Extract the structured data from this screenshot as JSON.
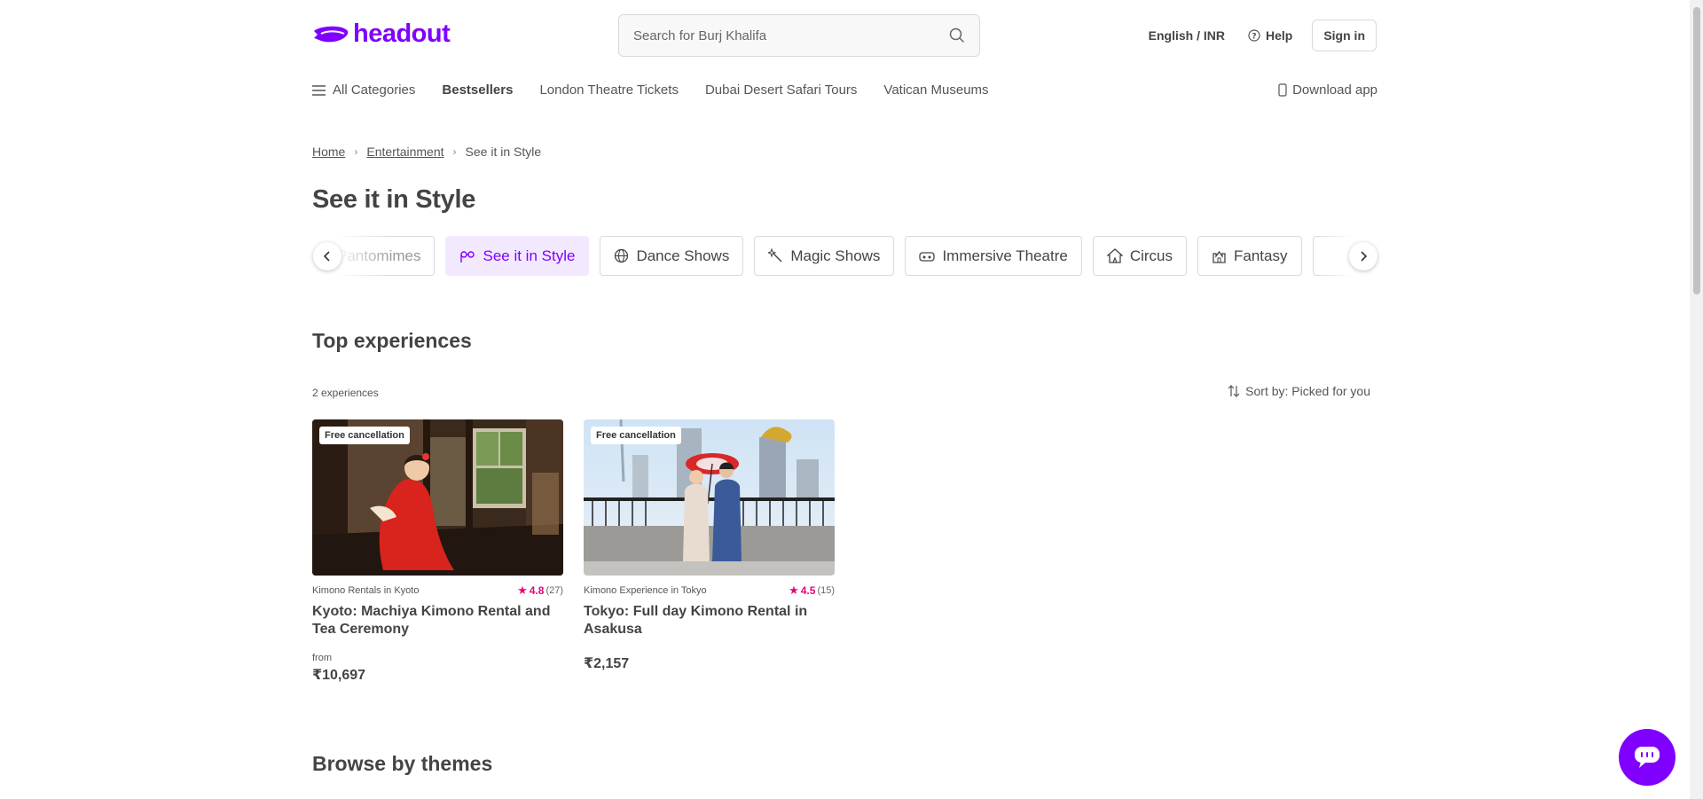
{
  "header": {
    "logo_text": "headout",
    "brand_color": "#8000ff",
    "search_placeholder": "Search for Burj Khalifa",
    "language_currency": "English / INR",
    "help": "Help",
    "sign_in": "Sign in"
  },
  "nav": {
    "items": [
      "All Categories",
      "Bestsellers",
      "London Theatre Tickets",
      "Dubai Desert Safari Tours",
      "Vatican Museums"
    ],
    "download_app": "Download app"
  },
  "breadcrumb": {
    "items": [
      "Home",
      "Entertainment",
      "See it in Style"
    ]
  },
  "page_title": "See it in Style",
  "categories": {
    "chips": [
      {
        "label": "Pantomimes",
        "icon": "mask-icon"
      },
      {
        "label": "See it in Style",
        "icon": "glasses-icon"
      },
      {
        "label": "Dance Shows",
        "icon": "globe-icon"
      },
      {
        "label": "Magic Shows",
        "icon": "magic-wand-icon"
      },
      {
        "label": "Immersive Theatre",
        "icon": "vr-headset-icon"
      },
      {
        "label": "Circus",
        "icon": "circus-tent-icon"
      },
      {
        "label": "Fantasy",
        "icon": "castle-icon"
      }
    ],
    "active": "See it in Style"
  },
  "top_experiences": {
    "title": "Top experiences",
    "count": "2 experiences",
    "sort_label": "Sort by: Picked for you",
    "cards": [
      {
        "badge": "Free cancellation",
        "category": "Kimono Rentals in Kyoto",
        "rating": "4.8",
        "reviews": "(27)",
        "title": "Kyoto: Machiya Kimono Rental and Tea Ceremony",
        "price_prefix": "from",
        "price": "₹10,697"
      },
      {
        "badge": "Free cancellation",
        "category": "Kimono Experience in Tokyo",
        "rating": "4.5",
        "reviews": "(15)",
        "title": "Tokyo: Full day Kimono Rental in Asakusa",
        "price": "₹2,157"
      }
    ]
  },
  "browse_title": "Browse by themes",
  "colors": {
    "rating": "#e6007e",
    "active_chip_bg": "#f3e9ff",
    "text": "#444444"
  }
}
